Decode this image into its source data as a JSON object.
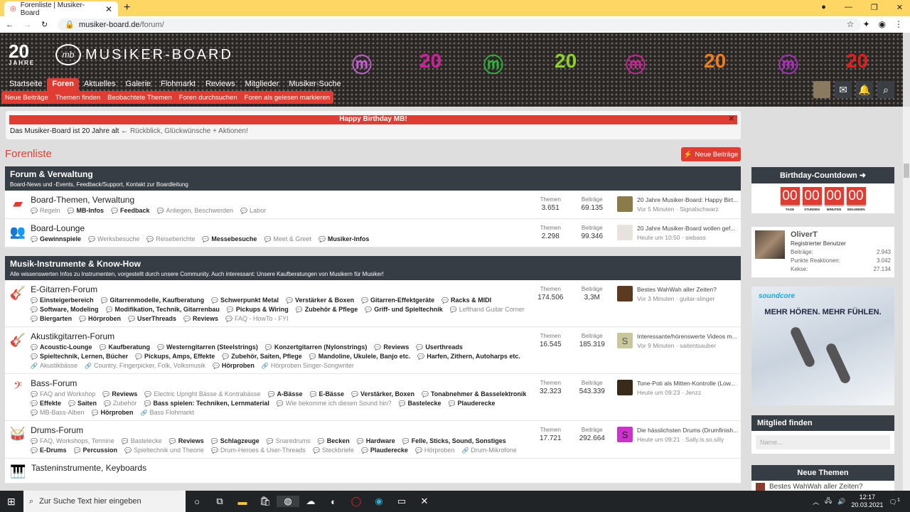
{
  "browser": {
    "tab_title": "Forenliste | Musiker-Board",
    "url_host": "musiker-board.de",
    "url_path": "/forum/"
  },
  "header": {
    "logo_years": "20",
    "logo_years_label": "JAHRE",
    "logo_text": "MUSIKER-BOARD",
    "logo_mark": "mb"
  },
  "nav": [
    "Startseite",
    "Foren",
    "Aktuelles",
    "Galerie",
    "Flohmarkt",
    "Reviews",
    "Mitglieder",
    "Musiker-Suche"
  ],
  "subnav": [
    "Neue Beiträge",
    "Themen finden",
    "Beobachtete Themen",
    "Foren durchsuchen",
    "Foren als gelesen markieren"
  ],
  "notice": {
    "title": "Happy Birthday MB!",
    "text": "Das Musiker-Board ist 20 Jahre alt ←",
    "link": "Rückblick, Glückwünsche + Aktionen!"
  },
  "page": {
    "title": "Forenliste",
    "new_posts_button": "Neue Beiträge"
  },
  "labels": {
    "threads": "Themen",
    "posts": "Beiträge"
  },
  "categories": [
    {
      "title": "Forum & Verwaltung",
      "desc": "Board-News und -Events, Feedback/Support, Kontakt zur Boardleitung",
      "nodes": [
        {
          "icon": "speech-bubble",
          "title": "Board-Themen, Verwaltung",
          "subs": [
            [
              "Regeln",
              0
            ],
            [
              "MB-Infos",
              1
            ],
            [
              "Feedback",
              1
            ],
            [
              "Anliegen, Beschwerden",
              0
            ],
            [
              "Labor",
              0
            ]
          ],
          "threads": "3.651",
          "posts": "69.135",
          "last_title": "20 Jahre Musiker-Board: Happy Birt...",
          "last_meta": "Vor 5 Minuten · Signalschwarz",
          "avatar": "",
          "avatar_color": "#8b7b4a"
        },
        {
          "icon": "users",
          "title": "Board-Lounge",
          "subs": [
            [
              "Gewinnspiele",
              1
            ],
            [
              "Werksbesuche",
              0
            ],
            [
              "Reiseberichte",
              0
            ],
            [
              "Messebesuche",
              1
            ],
            [
              "Meet & Greet",
              0
            ],
            [
              "Musiker-Infos",
              1
            ]
          ],
          "threads": "2.298",
          "posts": "99.346",
          "last_title": "20 Jahre Musiker-Board wollen gef...",
          "last_meta": "Heute um 10:50 · siebass",
          "avatar": "",
          "avatar_color": "#e8e2dc"
        }
      ]
    },
    {
      "title": "Musik-Instrumente & Know-How",
      "desc": "Alle wissenswerten Infos zu Instrumenten, vorgestellt durch unsere Community. Auch interessant: Unsere Kaufberatungen von Musikern für Musiker!",
      "nodes": [
        {
          "icon": "electric-guitar",
          "title": "E-Gitarren-Forum",
          "subs": [
            [
              "Einsteigerbereich",
              1
            ],
            [
              "Gitarrenmodelle, Kaufberatung",
              1
            ],
            [
              "Schwerpunkt Metal",
              1
            ],
            [
              "Verstärker & Boxen",
              1
            ],
            [
              "Gitarren-Effektgeräte",
              1
            ],
            [
              "Racks & MIDI",
              1
            ],
            [
              "Software, Modeling",
              1
            ],
            [
              "Modifikation, Technik, Gitarrenbau",
              1
            ],
            [
              "Pickups & Wiring",
              1
            ],
            [
              "Zubehör & Pflege",
              1
            ],
            [
              "Griff- und Spieltechnik",
              1
            ],
            [
              "Lefthand Guitar Corner",
              0
            ],
            [
              "Biergarten",
              1
            ],
            [
              "Hörproben",
              1
            ],
            [
              "UserThreads",
              1
            ],
            [
              "Reviews",
              1
            ],
            [
              "FAQ - HowTo - FYI",
              0
            ]
          ],
          "threads": "174.506",
          "posts": "3,3M",
          "last_title": "Bestes WahWah aller Zeiten?",
          "last_meta": "Vor 3 Minuten · guitar-slinger",
          "avatar": "",
          "avatar_color": "#5a3a20"
        },
        {
          "icon": "acoustic-guitar",
          "title": "Akustikgitarren-Forum",
          "subs": [
            [
              "Acoustic-Lounge",
              1
            ],
            [
              "Kaufberatung",
              1
            ],
            [
              "Westerngitarren (Steelstrings)",
              1
            ],
            [
              "Konzertgitarren (Nylonstrings)",
              1
            ],
            [
              "Reviews",
              1
            ],
            [
              "Userthreads",
              1
            ],
            [
              "Spieltechnik, Lernen, Bücher",
              1
            ],
            [
              "Pickups, Amps, Effekte",
              1
            ],
            [
              "Zubehör, Saiten, Pflege",
              1
            ],
            [
              "Mandoline, Ukulele, Banjo etc.",
              1
            ],
            [
              "Harfen, Zithern, Autoharps etc.",
              1
            ],
            [
              "Akustikbässe",
              2
            ],
            [
              "Country, Fingerpicker, Folk, Volksmusik",
              2
            ],
            [
              "Hörproben",
              1
            ],
            [
              "Hörproben Singer-Songwriter",
              2
            ]
          ],
          "threads": "16.545",
          "posts": "185.319",
          "last_title": "Interessante/hörenswerte Videos m...",
          "last_meta": "Vor 9 Minuten · saitentsauber",
          "avatar": "S",
          "avatar_color": "#c8c89c"
        },
        {
          "icon": "bass-clef",
          "title": "Bass-Forum",
          "subs": [
            [
              "FAQ and Workshop",
              0
            ],
            [
              "Reviews",
              1
            ],
            [
              "Electric Upright Bässe & Kontrabässe",
              0
            ],
            [
              "A-Bässe",
              1
            ],
            [
              "E-Bässe",
              1
            ],
            [
              "Verstärker, Boxen",
              1
            ],
            [
              "Tonabnehmer & Basselektronik",
              1
            ],
            [
              "Effekte",
              1
            ],
            [
              "Saiten",
              1
            ],
            [
              "Zubehör",
              0
            ],
            [
              "Bass spielen: Techniken, Lernmaterial",
              1
            ],
            [
              "Wie bekomme ich diesen Sound hin?",
              0
            ],
            [
              "Bastelecke",
              1
            ],
            [
              "Plauderecke",
              1
            ],
            [
              "MB-Bass-Alben",
              0
            ],
            [
              "Hörproben",
              1
            ],
            [
              "Bass Flohmarkt",
              2
            ]
          ],
          "threads": "32.323",
          "posts": "543.339",
          "last_title": "Tone-Poti als Mitten-Kontrolle (Low...",
          "last_meta": "Heute um 09:23 · Jenzz",
          "avatar": "",
          "avatar_color": "#3a2a1a"
        },
        {
          "icon": "drum",
          "title": "Drums-Forum",
          "subs": [
            [
              "FAQ, Workshops, Termine",
              0
            ],
            [
              "Bastelecke",
              0
            ],
            [
              "Reviews",
              1
            ],
            [
              "Schlagzeuge",
              1
            ],
            [
              "Snaredrums",
              0
            ],
            [
              "Becken",
              1
            ],
            [
              "Hardware",
              1
            ],
            [
              "Felle, Sticks, Sound, Sonstiges",
              1
            ],
            [
              "E-Drums",
              1
            ],
            [
              "Percussion",
              1
            ],
            [
              "Spieltechnik und Theorie",
              0
            ],
            [
              "Drum-Heroes & User-Threads",
              0
            ],
            [
              "Steckbriefe",
              0
            ],
            [
              "Plauderecke",
              1
            ],
            [
              "Hörproben",
              0
            ],
            [
              "Drum-Mikrofone",
              2
            ]
          ],
          "threads": "17.721",
          "posts": "292.664",
          "last_title": "Die hässlichsten Drums (Drumfinish...",
          "last_meta": "Heute um 09:21 · Sally.is.so.silly",
          "avatar": "S",
          "avatar_color": "#cc33cc"
        },
        {
          "icon": "piano",
          "title": "Tasteninstrumente, Keyboards",
          "subs": [],
          "threads": "",
          "posts": "",
          "last_title": "",
          "last_meta": "",
          "avatar": "",
          "avatar_color": "#fff"
        }
      ]
    }
  ],
  "sidebar": {
    "countdown": {
      "title": "Birthday-Countdown ➜",
      "values": [
        "00",
        "00",
        "00",
        "00"
      ],
      "labels": [
        "TAGE",
        "STUNDEN",
        "MINUTEN",
        "SEKUNDEN"
      ]
    },
    "user": {
      "name": "OliverT",
      "role": "Registrierter Benutzer",
      "rows": [
        [
          "Beiträge:",
          "2.943"
        ],
        [
          "Punkte Reaktionen:",
          "3.042"
        ],
        [
          "Kekse:",
          "27.134"
        ]
      ]
    },
    "ad": {
      "brand": "soundcore",
      "slogan": "MEHR HÖREN. MEHR FÜHLEN."
    },
    "find_member": {
      "title": "Mitglied finden",
      "placeholder": "Name..."
    },
    "new_threads": {
      "title": "Neue Themen",
      "first": "Bestes WahWah aller Zeiten?"
    }
  },
  "taskbar": {
    "search_placeholder": "Zur Suche Text hier eingeben",
    "time": "12:17",
    "date": "20.03.2021",
    "notifications": "1"
  }
}
